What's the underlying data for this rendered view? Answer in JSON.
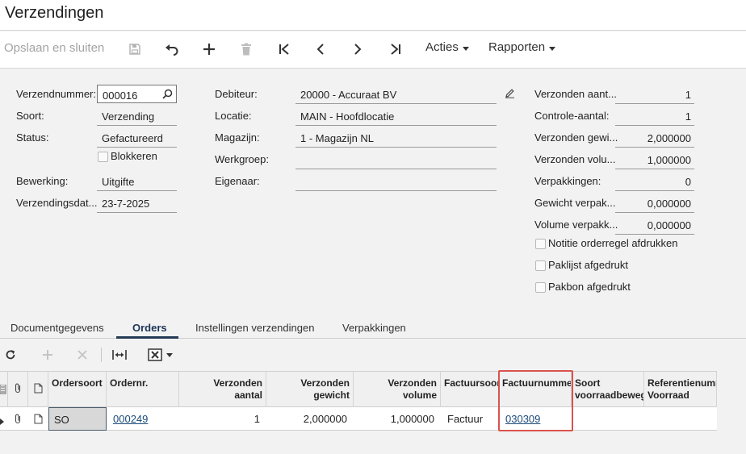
{
  "window": {
    "title": "Verzendingen"
  },
  "toolbar": {
    "save_close_label": "Opslaan en sluiten",
    "actions_label": "Acties",
    "reports_label": "Rapporten"
  },
  "form": {
    "shipment_number": {
      "label": "Verzendnummer:",
      "value": "000016"
    },
    "type": {
      "label": "Soort:",
      "value": "Verzending"
    },
    "status": {
      "label": "Status:",
      "value": "Gefactureerd"
    },
    "hold": {
      "label": "Blokkeren"
    },
    "operation": {
      "label": "Bewerking:",
      "value": "Uitgifte"
    },
    "shipment_date": {
      "label": "Verzendingsdat...",
      "value": "23-7-2025"
    },
    "customer": {
      "label": "Debiteur:",
      "value": "20000 - Accuraat BV"
    },
    "location": {
      "label": "Locatie:",
      "value": "MAIN - Hoofdlocatie"
    },
    "warehouse": {
      "label": "Magazijn:",
      "value": "1 - Magazijn NL"
    },
    "workgroup": {
      "label": "Werkgroep:",
      "value": ""
    },
    "owner": {
      "label": "Eigenaar:",
      "value": ""
    },
    "shipped_qty": {
      "label": "Verzonden aant...",
      "value": "1"
    },
    "control_qty": {
      "label": "Controle-aantal:",
      "value": "1"
    },
    "shipped_weight": {
      "label": "Verzonden gewi...",
      "value": "2,000000"
    },
    "shipped_volume": {
      "label": "Verzonden volu...",
      "value": "1,000000"
    },
    "packages": {
      "label": "Verpakkingen:",
      "value": "0"
    },
    "package_weight": {
      "label": "Gewicht verpak...",
      "value": "0,000000"
    },
    "package_volume": {
      "label": "Volume verpakk...",
      "value": "0,000000"
    },
    "print_line_notes": {
      "label": "Notitie orderregel afdrukken"
    },
    "packing_list_printed": {
      "label": "Paklijst afgedrukt"
    },
    "pick_list_printed": {
      "label": "Pakbon afgedrukt"
    }
  },
  "tabs": [
    "Documentgegevens",
    "Orders",
    "Instellingen verzendingen",
    "Verpakkingen"
  ],
  "grid": {
    "headers": {
      "order_type": "Ordersoort",
      "order_nbr": "Ordernr.",
      "shipped_qty_1": "Verzonden",
      "shipped_qty_2": "aantal",
      "shipped_weight_1": "Verzonden",
      "shipped_weight_2": "gewicht",
      "shipped_volume_1": "Verzonden",
      "shipped_volume_2": "volume",
      "invoice_type": "Factuursoort",
      "invoice_nbr": "Factuurnummer",
      "alloc_type_1": "Soort",
      "alloc_type_2": "voorraadbeweging",
      "inventory_ref_1": "Referentienummer",
      "inventory_ref_2": "Voorraad"
    },
    "rows": [
      {
        "order_type": "SO",
        "order_nbr": "000249",
        "shipped_qty": "1",
        "shipped_weight": "2,000000",
        "shipped_volume": "1,000000",
        "invoice_type": "Factuur",
        "invoice_nbr": "030309",
        "alloc_type": "",
        "inventory_ref": ""
      }
    ]
  },
  "colors": {
    "accent": "#243b55",
    "link": "#1a4a7a",
    "highlight": "#d9534f"
  }
}
